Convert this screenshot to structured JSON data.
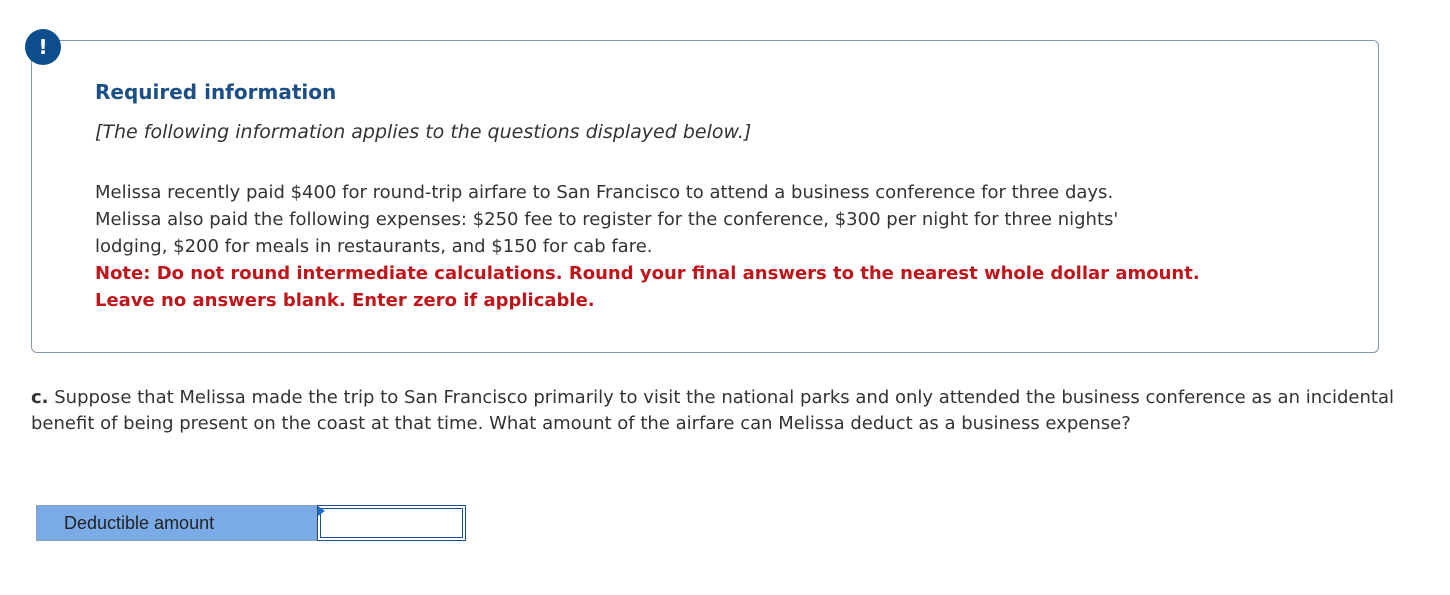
{
  "badge": {
    "symbol": "!"
  },
  "info": {
    "title": "Required information",
    "subtitle": "[The following information applies to the questions displayed below.]",
    "body_lines": [
      "Melissa recently paid $400 for round-trip airfare to San Francisco to attend a business conference for three days.",
      "Melissa also paid the following expenses: $250 fee to register for the conference, $300 per night for three nights'",
      "lodging, $200 for meals in restaurants, and $150 for cab fare."
    ],
    "note_lines": [
      "Note: Do not round intermediate calculations. Round your final answers to the nearest whole dollar amount.",
      "Leave no answers blank. Enter zero if applicable."
    ]
  },
  "question": {
    "label": "c.",
    "text": " Suppose that Melissa made the trip to San Francisco primarily to visit the national parks and only attended the business conference as an incidental benefit of being present on the coast at that time. What amount of the airfare can Melissa deduct as a business expense?"
  },
  "answer": {
    "label": "Deductible amount",
    "value": ""
  },
  "colors": {
    "accent": "#1b4f86",
    "badge": "#0d4f8c",
    "note": "#c0161b",
    "label_bg": "#7aabe6"
  }
}
